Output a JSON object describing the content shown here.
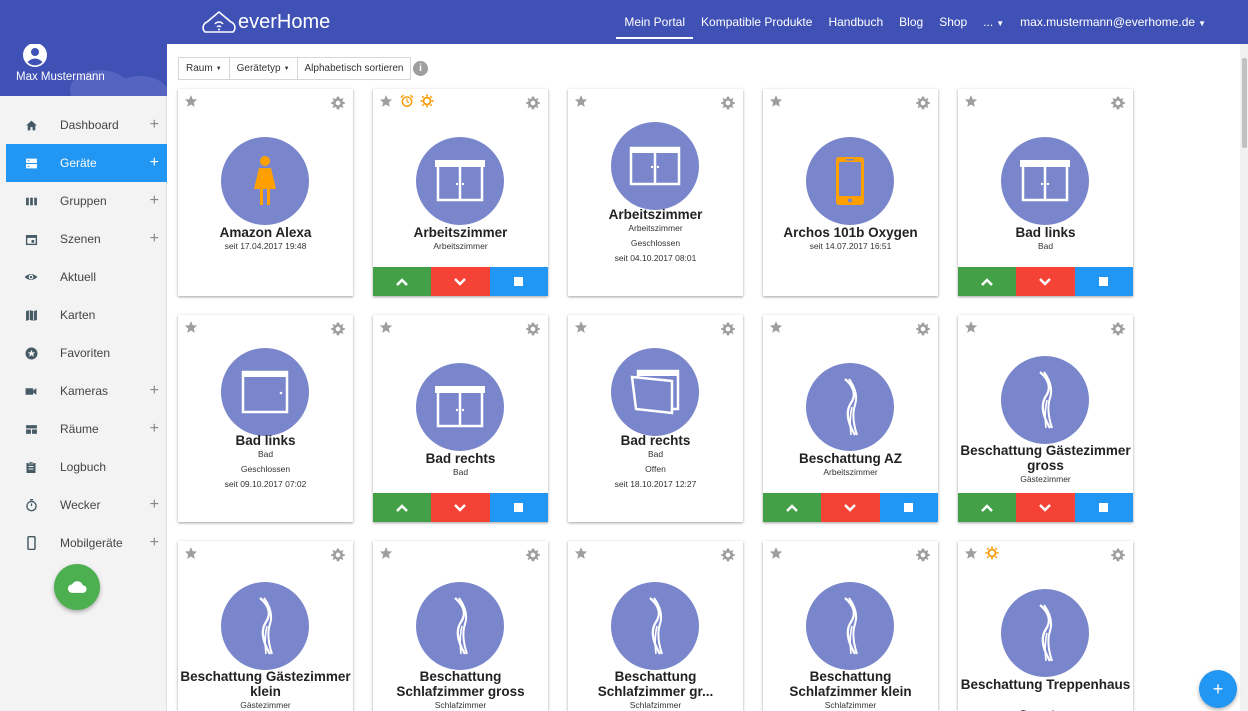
{
  "brand": {
    "name": "everHome"
  },
  "topnav": {
    "links": [
      "Mein Portal",
      "Kompatible Produkte",
      "Handbuch",
      "Blog",
      "Shop",
      "..."
    ],
    "account": "max.mustermann@everhome.de"
  },
  "user": {
    "name": "Max Mustermann"
  },
  "sidebar": {
    "items": [
      {
        "label": "Dashboard",
        "icon": "home-icon",
        "plus": true
      },
      {
        "label": "Geräte",
        "icon": "devices-icon",
        "plus": true
      },
      {
        "label": "Gruppen",
        "icon": "groups-icon",
        "plus": true
      },
      {
        "label": "Szenen",
        "icon": "calendar-icon",
        "plus": true
      },
      {
        "label": "Aktuell",
        "icon": "eye-icon",
        "plus": false
      },
      {
        "label": "Karten",
        "icon": "map-icon",
        "plus": false
      },
      {
        "label": "Favoriten",
        "icon": "star-circle-icon",
        "plus": false
      },
      {
        "label": "Kameras",
        "icon": "camera-icon",
        "plus": true
      },
      {
        "label": "Räume",
        "icon": "rooms-icon",
        "plus": true
      },
      {
        "label": "Logbuch",
        "icon": "clipboard-icon",
        "plus": false
      },
      {
        "label": "Wecker",
        "icon": "timer-icon",
        "plus": true
      },
      {
        "label": "Mobilgeräte",
        "icon": "phone-icon",
        "plus": true
      }
    ],
    "active": "Geräte"
  },
  "filters": {
    "room": "Raum",
    "type": "Gerätetyp",
    "sort": "Alphabetisch sortieren"
  },
  "cards": [
    {
      "name": "Amazon Alexa",
      "lines": [
        "seit 17.04.2017 19:48"
      ],
      "icon": "person-icon"
    },
    {
      "name": "Arbeitszimmer",
      "lines": [
        "Arbeitszimmer"
      ],
      "icon": "shutter-icon"
    },
    {
      "name": "Arbeitszimmer",
      "lines": [
        "Arbeitszimmer",
        "Geschlossen",
        "seit 04.10.2017 08:01"
      ],
      "icon": "window-icon"
    },
    {
      "name": "Archos 101b Oxygen",
      "lines": [
        "seit 14.07.2017 16:51"
      ],
      "icon": "smartphone-icon"
    },
    {
      "name": "Bad links",
      "lines": [
        "Bad"
      ],
      "icon": "shutter-icon"
    },
    {
      "name": "Bad links",
      "lines": [
        "Bad",
        "Geschlossen",
        "seit 09.10.2017 07:02"
      ],
      "icon": "door-icon"
    },
    {
      "name": "Bad rechts",
      "lines": [
        "Bad"
      ],
      "icon": "shutter-icon"
    },
    {
      "name": "Bad rechts",
      "lines": [
        "Bad",
        "Offen",
        "seit 18.10.2017 12:27"
      ],
      "icon": "window-open-icon"
    },
    {
      "name": "Beschattung AZ",
      "lines": [
        "Arbeitszimmer"
      ],
      "icon": "awning-icon"
    },
    {
      "name": "Beschattung Gästezimmer gross",
      "lines": [
        "Gästezimmer"
      ],
      "icon": "awning-icon"
    },
    {
      "name": "Beschattung Gästezimmer klein",
      "lines": [
        "Gästezimmer"
      ],
      "icon": "awning-icon"
    },
    {
      "name": "Beschattung Schlafzimmer gross",
      "lines": [
        "Schlafzimmer"
      ],
      "icon": "awning-icon"
    },
    {
      "name": "Beschattung Schlafzimmer gr...",
      "lines": [
        "Schlafzimmer"
      ],
      "icon": "awning-icon"
    },
    {
      "name": "Beschattung Schlafzimmer klein",
      "lines": [
        "Schlafzimmer"
      ],
      "icon": "awning-icon"
    },
    {
      "name": "Beschattung Treppenhaus",
      "lines": [
        "Treppenhaus"
      ],
      "icon": "awning-icon"
    }
  ],
  "fab": "+",
  "colors": {
    "primary": "#3f51b5",
    "accent": "#2196f3",
    "device_circle": "#7986cb",
    "up": "#43a047",
    "down": "#f44336",
    "stop": "#2196f3",
    "warning": "#ff9800"
  }
}
